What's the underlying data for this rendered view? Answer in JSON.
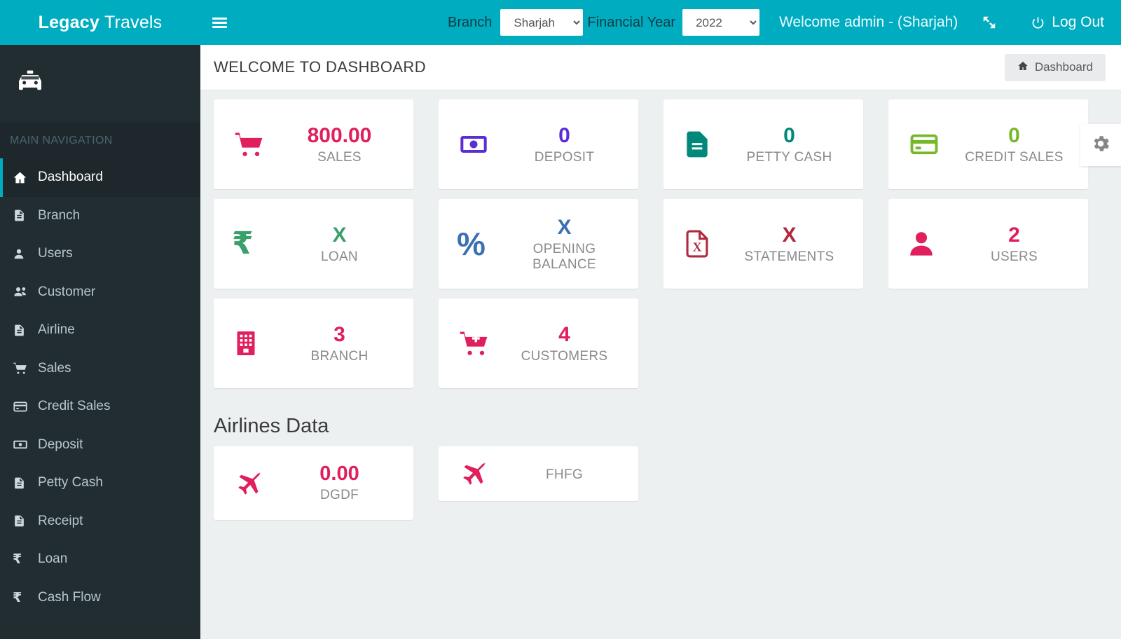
{
  "header": {
    "brand_bold": "Legacy",
    "brand_light": "Travels",
    "menu_toggle": "hamburger-menu",
    "branch_label": "Branch",
    "branch_value": "Sharjah",
    "branch_options": [
      "Sharjah"
    ],
    "financial_year_label": "Financial Year",
    "financial_year_value": "2022",
    "financial_year_options": [
      "2022"
    ],
    "welcome_text": "Welcome admin - (Sharjah)",
    "fullscreen_icon": "expand-arrows-icon",
    "logout_label": "Log Out",
    "accent_color": "#00acc0"
  },
  "sidebar": {
    "user_icon": "taxi-icon",
    "nav_header": "MAIN NAVIGATION",
    "items": [
      {
        "label": "Dashboard",
        "icon": "home-icon",
        "active": true
      },
      {
        "label": "Branch",
        "icon": "file-text-icon",
        "active": false
      },
      {
        "label": "Users",
        "icon": "user-icon",
        "active": false
      },
      {
        "label": "Customer",
        "icon": "users-group-icon",
        "active": false
      },
      {
        "label": "Airline",
        "icon": "file-text-icon",
        "active": false
      },
      {
        "label": "Sales",
        "icon": "shopping-cart-icon",
        "active": false
      },
      {
        "label": "Credit Sales",
        "icon": "credit-card-icon",
        "active": false
      },
      {
        "label": "Deposit",
        "icon": "money-bill-icon",
        "active": false
      },
      {
        "label": "Petty Cash",
        "icon": "file-text-icon",
        "active": false
      },
      {
        "label": "Receipt",
        "icon": "file-text-icon",
        "active": false
      },
      {
        "label": "Loan",
        "icon": "rupee-icon",
        "active": false
      },
      {
        "label": "Cash Flow",
        "icon": "rupee-icon",
        "active": false
      }
    ]
  },
  "page": {
    "title": "WELCOME TO DASHBOARD",
    "breadcrumb_label": "Dashboard",
    "breadcrumb_icon": "home-icon",
    "settings_tab_icon": "gear-icon"
  },
  "stats": [
    {
      "value": "800.00",
      "label": "SALES",
      "icon": "shopping-cart-icon",
      "color": "#e01f5c"
    },
    {
      "value": "0",
      "label": "DEPOSIT",
      "icon": "money-bill-icon",
      "color": "#5b2dd6"
    },
    {
      "value": "0",
      "label": "PETTY CASH",
      "icon": "file-text-icon",
      "color": "#00897b"
    },
    {
      "value": "0",
      "label": "CREDIT SALES",
      "icon": "credit-card-icon",
      "color": "#76b82a"
    },
    {
      "value": "X",
      "label": "LOAN",
      "icon": "rupee-icon",
      "color": "#3aa06b"
    },
    {
      "value": "X",
      "label": "OPENING BALANCE",
      "icon": "percent-icon",
      "color": "#3b71b0"
    },
    {
      "value": "X",
      "label": "STATEMENTS",
      "icon": "file-excel-icon",
      "color": "#b0293f"
    },
    {
      "value": "2",
      "label": "USERS",
      "icon": "user-icon",
      "color": "#e01f5c"
    },
    {
      "value": "3",
      "label": "BRANCH",
      "icon": "building-icon",
      "color": "#e01f5c"
    },
    {
      "value": "4",
      "label": "CUSTOMERS",
      "icon": "cart-plus-icon",
      "color": "#e01f5c"
    }
  ],
  "airlines": {
    "section_title": "Airlines Data",
    "items": [
      {
        "value": "0.00",
        "label": "DGDF",
        "icon": "plane-icon",
        "color": "#e01f5c",
        "short": false
      },
      {
        "value": "",
        "label": "FHFG",
        "icon": "plane-icon",
        "color": "#e01f5c",
        "short": true
      }
    ]
  }
}
